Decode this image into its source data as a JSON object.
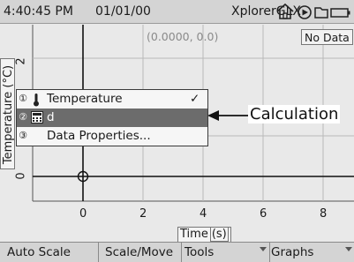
{
  "status_bar": {
    "time": "4:40:45 PM",
    "date": "01/01/00",
    "app_name": "XplorerGLX",
    "icons": [
      "home-icon",
      "play-icon",
      "folder-icon",
      "battery-icon"
    ]
  },
  "graph": {
    "cursor_readout": "(0.0000, 0.0)",
    "no_data_label": "No Data",
    "y_axis_label": "Temperature (°C)",
    "x_axis_label": "Time",
    "x_axis_unit": "(s)",
    "x_ticks": [
      "0",
      "2",
      "4",
      "6",
      "8"
    ],
    "y_ticks": [
      "2",
      "0"
    ]
  },
  "menu": {
    "items": [
      {
        "number": "①",
        "icon": "thermometer-icon",
        "label": "Temperature",
        "checked": true
      },
      {
        "number": "②",
        "icon": "calculator-icon",
        "label": "d",
        "checked": false,
        "selected": true
      },
      {
        "number": "③",
        "icon": "",
        "label": "Data Properties...",
        "checked": false
      }
    ],
    "check_mark": "✓"
  },
  "annotation": {
    "label": "Calculation"
  },
  "bottom_bar": {
    "auto_scale": "Auto Scale",
    "scale_move": "Scale/Move",
    "tools": "Tools",
    "graphs": "Graphs"
  },
  "colors": {
    "background": "#e9e9e9",
    "bar": "#d4d4d4",
    "selected_item": "#6c6c6c"
  }
}
